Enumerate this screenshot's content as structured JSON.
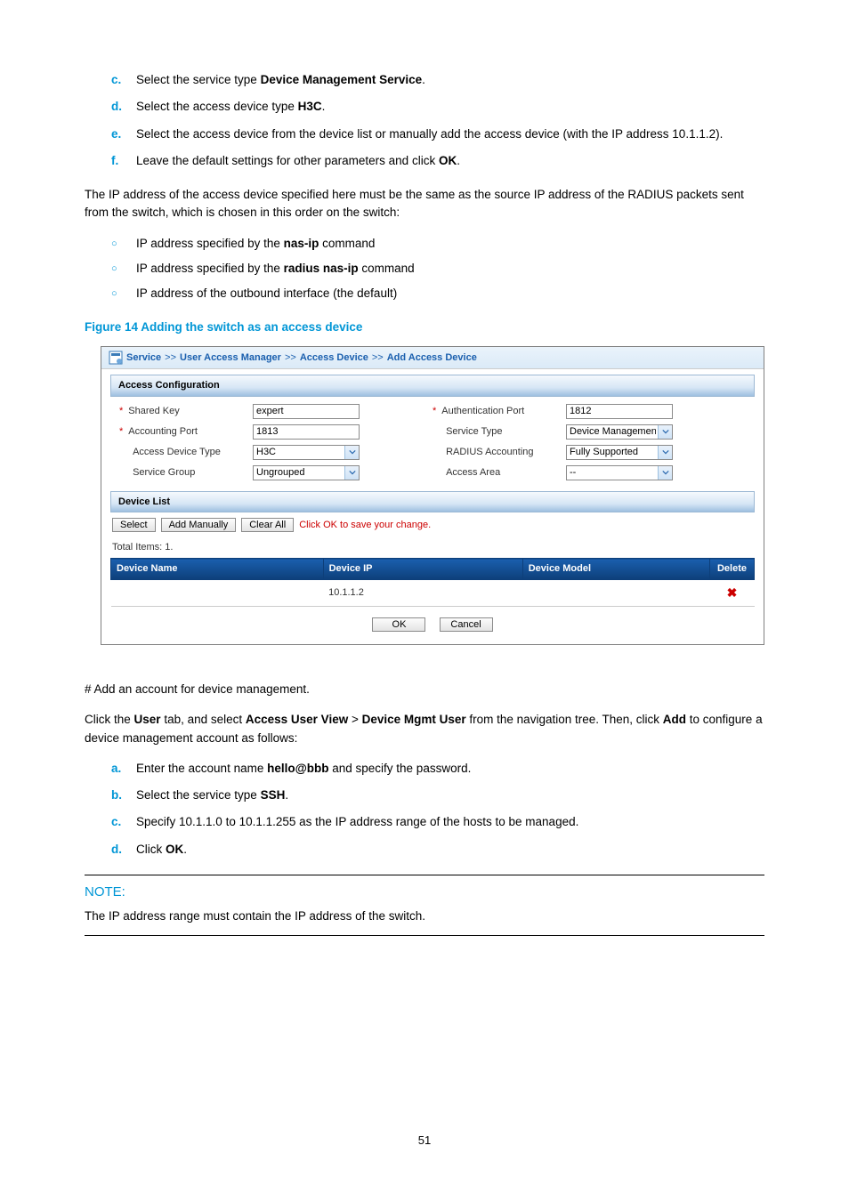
{
  "steps1": {
    "c": {
      "marker": "c.",
      "pre": "Select the service type ",
      "bold": "Device Management Service",
      "post": "."
    },
    "d": {
      "marker": "d.",
      "pre": "Select the access device type ",
      "bold": "H3C",
      "post": "."
    },
    "e": {
      "marker": "e.",
      "text": "Select the access device from the device list or manually add the access device (with the IP address 10.1.1.2)."
    },
    "f": {
      "marker": "f.",
      "pre": "Leave the default settings for other parameters and click ",
      "bold": "OK",
      "post": "."
    }
  },
  "para_ip": "The IP address of the access device specified here must be the same as the source IP address of the RADIUS packets sent from the switch, which is chosen in this order on the switch:",
  "bullets": {
    "a": {
      "pre": "IP address specified by the ",
      "bold": "nas-ip",
      "post": " command"
    },
    "b": {
      "pre": "IP address specified by the ",
      "bold": "radius nas-ip",
      "post": " command"
    },
    "c": {
      "text": "IP address of the outbound interface (the default)"
    }
  },
  "figure_caption": "Figure 14 Adding the switch as an access device",
  "ss": {
    "bc": {
      "a": "Service",
      "b": "User Access Manager",
      "c": "Access Device",
      "d": "Add Access Device",
      "sep": ">>"
    },
    "section1": "Access Configuration",
    "labels": {
      "shared_key": "Shared Key",
      "accounting_port": "Accounting Port",
      "access_device_type": "Access Device Type",
      "service_group": "Service Group",
      "auth_port": "Authentication Port",
      "service_type": "Service Type",
      "radius_acct": "RADIUS Accounting",
      "access_area": "Access Area"
    },
    "values": {
      "shared_key": "expert",
      "accounting_port": "1813",
      "access_device_type": "H3C",
      "service_group": "Ungrouped",
      "auth_port": "1812",
      "service_type": "Device Management S",
      "radius_acct": "Fully Supported",
      "access_area": "--"
    },
    "section2": "Device List",
    "btns": {
      "select": "Select",
      "add_manually": "Add Manually",
      "clear_all": "Clear All"
    },
    "hint": "Click OK to save your change.",
    "total": "Total Items: 1.",
    "th": {
      "name": "Device Name",
      "ip": "Device IP",
      "model": "Device Model",
      "del": "Delete"
    },
    "row": {
      "name": "",
      "ip": "10.1.1.2",
      "model": ""
    },
    "footer": {
      "ok": "OK",
      "cancel": "Cancel"
    }
  },
  "para_add": "# Add an account for device management.",
  "para_click": {
    "p1": "Click the ",
    "b1": "User",
    "p2": " tab, and select ",
    "b2": "Access User View",
    "p3": " > ",
    "b3": "Device Mgmt User",
    "p4": " from the navigation tree. Then, click ",
    "b4": "Add",
    "p5": " to configure a device management account as follows:"
  },
  "steps2": {
    "a": {
      "marker": "a.",
      "pre": "Enter the account name ",
      "bold": "hello@bbb",
      "post": " and specify the password."
    },
    "b": {
      "marker": "b.",
      "pre": "Select the service type ",
      "bold": "SSH",
      "post": "."
    },
    "c": {
      "marker": "c.",
      "text": "Specify 10.1.1.0 to 10.1.1.255 as the IP address range of the hosts to be managed."
    },
    "d": {
      "marker": "d.",
      "pre": "Click ",
      "bold": "OK",
      "post": "."
    }
  },
  "note": {
    "head": "NOTE:",
    "body": "The IP address range must contain the IP address of the switch."
  },
  "pagenum": "51"
}
